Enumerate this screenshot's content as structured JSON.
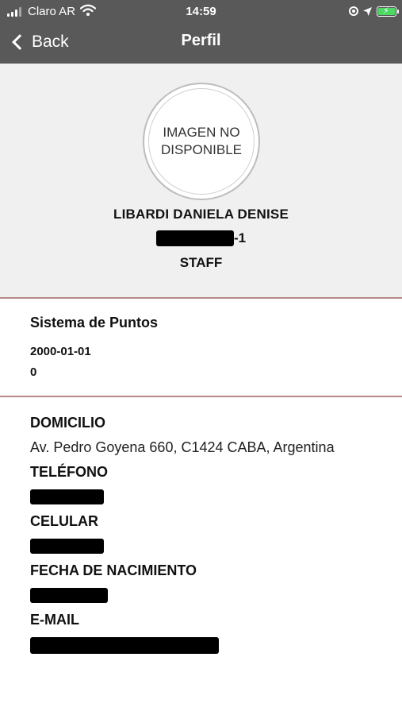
{
  "status_bar": {
    "carrier": "Claro AR",
    "time": "14:59",
    "signal_icon": "signal-bars-icon",
    "wifi_icon": "wifi-icon",
    "battery_icon": "battery-charging-icon"
  },
  "nav": {
    "back_label": "Back",
    "title": "Perfil"
  },
  "profile": {
    "avatar_text": "IMAGEN NO DISPONIBLE",
    "name": "LIBARDI DANIELA DENISE",
    "id_suffix": "-1",
    "role": "STAFF"
  },
  "points": {
    "title": "Sistema de Puntos",
    "date": "2000-01-01",
    "value": "0"
  },
  "details": {
    "address_label": "DOMICILIO",
    "address_value": "Av. Pedro Goyena 660, C1424 CABA, Argentina",
    "phone_label": "TELÉFONO",
    "mobile_label": "CELULAR",
    "birthdate_label": "FECHA DE NACIMIENTO",
    "email_label": "E-MAIL"
  },
  "colors": {
    "nav_background": "#595959",
    "header_background": "#f0f0f0",
    "divider": "#b88a8a",
    "battery_fill": "#4cd964"
  }
}
